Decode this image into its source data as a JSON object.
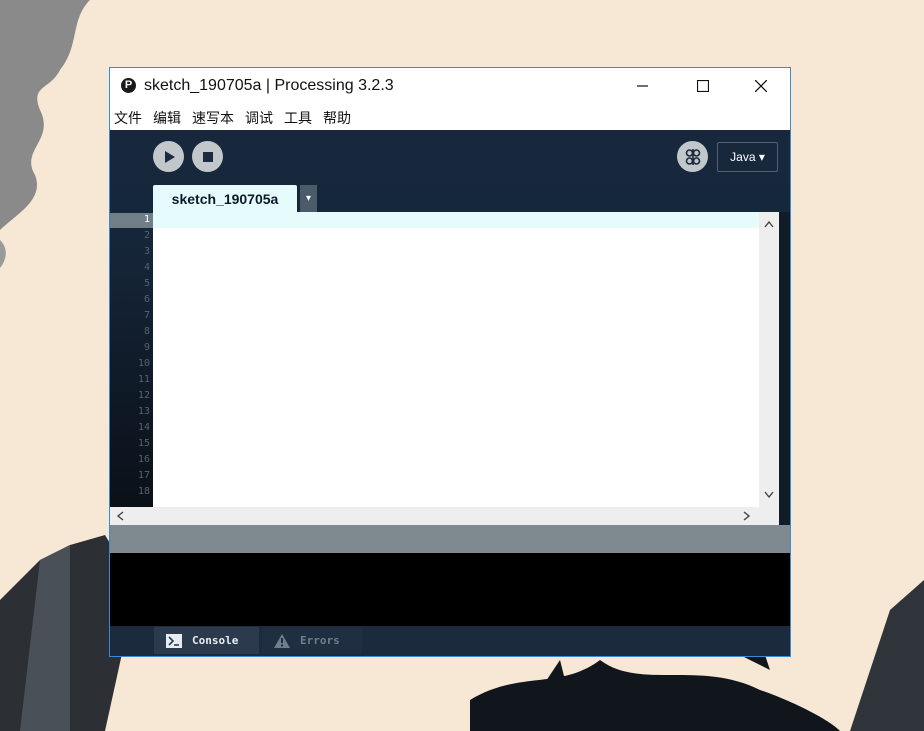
{
  "window": {
    "title": "sketch_190705a | Processing 3.2.3",
    "app_icon_letter": "P"
  },
  "menu": [
    "文件",
    "编辑",
    "速写本",
    "调试",
    "工具",
    "帮助"
  ],
  "toolbar": {
    "run_icon": "play-icon",
    "stop_icon": "stop-icon",
    "debugger_icon": "butterfly-icon",
    "mode_label": "Java ▾"
  },
  "tabs": {
    "active": "sketch_190705a",
    "menu_arrow": "▾"
  },
  "editor": {
    "line_numbers": [
      "1",
      "2",
      "3",
      "4",
      "5",
      "6",
      "7",
      "8",
      "9",
      "10",
      "11",
      "12",
      "13",
      "14",
      "15",
      "16",
      "17",
      "18"
    ],
    "current_line": "1"
  },
  "footer": {
    "console_label": "Console",
    "errors_label": "Errors"
  },
  "colors": {
    "toolbar_bg": "#17283d",
    "current_line_bg": "#e6fbfb",
    "console_bg": "#000000"
  }
}
